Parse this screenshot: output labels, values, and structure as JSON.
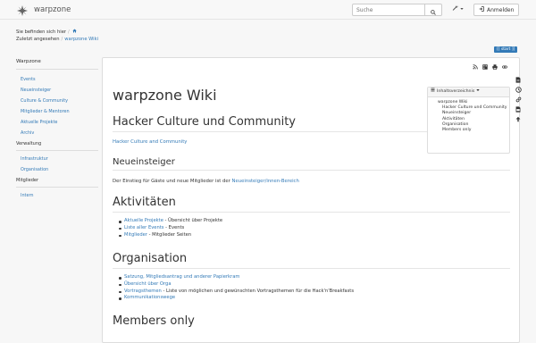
{
  "header": {
    "site_name": "warpzone",
    "search_placeholder": "Suche",
    "login_label": "Anmelden"
  },
  "breadcrumbs": {
    "here_label": "Sie befinden sich hier",
    "recent_label": "Zuletzt angesehen",
    "recent_link": "warpzone Wiki"
  },
  "start_button": "[[ start ]]",
  "sidebar": {
    "title": "Warpzone",
    "groups": [
      {
        "items": [
          "Events",
          "Neueinsteiger",
          "Culture & Community",
          "Mitglieder & Mentoren",
          "Aktuelle Projekte",
          "Archiv"
        ]
      },
      {
        "category": "Verwaltung",
        "items": [
          "Infrastruktur",
          "Organisation"
        ]
      },
      {
        "category": "Mitglieder",
        "items": [
          "Intern"
        ]
      }
    ]
  },
  "toc": {
    "title": "Inhaltsverzeichnis",
    "items": [
      "warpzone Wiki",
      "Hacker Culture und Community",
      "Neueinsteiger",
      "Aktivitäten",
      "Organisation",
      "Members only"
    ]
  },
  "content": {
    "title": "warpzone Wiki",
    "s1_heading": "Hacker Culture und Community",
    "s1_link": "Hacker Culture and Community",
    "s2_heading": "Neueinsteiger",
    "s2_text": "Der Einstieg für Gäste und neue Mitglieder ist der ",
    "s2_link": "Neueinsteiger/innen-Bereich",
    "s3_heading": "Aktivitäten",
    "s3_items": [
      {
        "link": "Aktuelle Projekte",
        "text": " - Übersicht über Projekte"
      },
      {
        "link": "Liste aller Events",
        "text": " - Events"
      },
      {
        "link": "Mitglieder",
        "text": " - Mitglieder Seiten"
      }
    ],
    "s4_heading": "Organisation",
    "s4_items": [
      {
        "link": "Satzung, Mitgliedsantrag und anderer Papierkram",
        "text": ""
      },
      {
        "link": "Übersicht über Orga",
        "text": ""
      },
      {
        "link": "Vortragsthemen",
        "text": " - Liste von möglichen und gewünschten Vortragsthemen für die Hack'n'Breakfasts"
      },
      {
        "link": "Kommunikationswege",
        "text": ""
      }
    ],
    "s5_heading": "Members only"
  },
  "colors": {
    "link": "#337ab7",
    "start_button_bg": "#337ab7"
  },
  "icons": {
    "navbar": [
      "warpzone-logo-icon",
      "search-icon",
      "wrench-icon",
      "sign-in-icon"
    ],
    "breadcrumb": [
      "home-icon"
    ],
    "page_tools": [
      "rss-icon",
      "qr-code-icon",
      "print-icon",
      "link-icon"
    ],
    "right_rail": [
      "document-icon",
      "history-icon",
      "backlinks-icon",
      "export-icon",
      "arrow-up-icon"
    ]
  }
}
